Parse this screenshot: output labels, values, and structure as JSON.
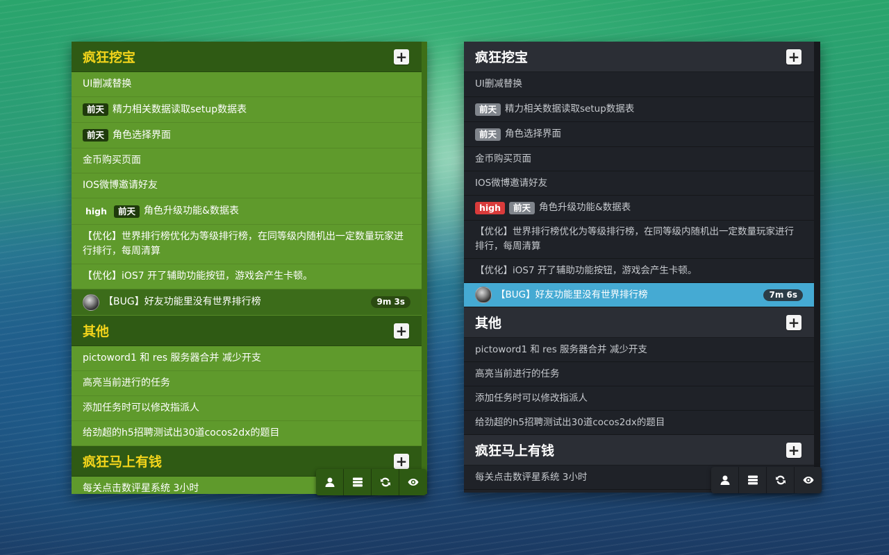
{
  "icons": {
    "add": "plus-icon",
    "user": "user-icon",
    "list": "list-icon",
    "refresh": "refresh-icon",
    "eye": "eye-icon"
  },
  "colors": {
    "green_panel": "#5f9a2c",
    "green_title": "#f4d51b",
    "dark_panel": "#1f2228",
    "active_blue": "#45aad3",
    "high_red": "#d93b3b"
  },
  "add_label": "+",
  "badges": {
    "day": "前天",
    "high": "high"
  },
  "left": {
    "groups": [
      {
        "title": "疯狂挖宝",
        "tasks": [
          {
            "text": "UI删减替换"
          },
          {
            "day": "前天",
            "text": "精力相关数据读取setup数据表"
          },
          {
            "day": "前天",
            "text": "角色选择界面"
          },
          {
            "text": "金币购买页面"
          },
          {
            "text": "IOS微博邀请好友"
          },
          {
            "high": "high",
            "day": "前天",
            "text": "角色升级功能&数据表"
          },
          {
            "text": "【优化】世界排行榜优化为等级排行榜，在同等级内随机出一定数量玩家进行排行，每周清算"
          },
          {
            "text": "【优化】iOS7 开了辅助功能按钮，游戏会产生卡顿。"
          },
          {
            "text": "【BUG】好友功能里没有世界排行榜",
            "timer": "9m 3s"
          }
        ]
      },
      {
        "title": "其他",
        "tasks": [
          {
            "text": "pictoword1 和 res 服务器合并 减少开支"
          },
          {
            "text": "高亮当前进行的任务"
          },
          {
            "text": "添加任务时可以修改指派人"
          },
          {
            "text": "给劲超的h5招聘测试出30道cocos2dx的题目"
          }
        ]
      },
      {
        "title": "疯狂马上有钱",
        "tasks": [
          {
            "text": "每关点击数评星系统 3小时"
          }
        ]
      }
    ]
  },
  "right": {
    "groups": [
      {
        "title": "疯狂挖宝",
        "tasks": [
          {
            "text": "UI删减替换"
          },
          {
            "day": "前天",
            "text": "精力相关数据读取setup数据表"
          },
          {
            "day": "前天",
            "text": "角色选择界面"
          },
          {
            "text": "金币购买页面"
          },
          {
            "text": "IOS微博邀请好友"
          },
          {
            "high": "high",
            "day": "前天",
            "text": "角色升级功能&数据表"
          },
          {
            "text": "【优化】世界排行榜优化为等级排行榜，在同等级内随机出一定数量玩家进行排行，每周清算"
          },
          {
            "text": "【优化】iOS7 开了辅助功能按钮，游戏会产生卡顿。"
          },
          {
            "text": "【BUG】好友功能里没有世界排行榜",
            "timer": "7m 6s"
          }
        ]
      },
      {
        "title": "其他",
        "tasks": [
          {
            "text": "pictoword1 和 res 服务器合并 减少开支"
          },
          {
            "text": "高亮当前进行的任务"
          },
          {
            "text": "添加任务时可以修改指派人"
          },
          {
            "text": "给劲超的h5招聘测试出30道cocos2dx的题目"
          }
        ]
      },
      {
        "title": "疯狂马上有钱",
        "tasks": [
          {
            "text": "每关点击数评星系统 3小时"
          }
        ]
      }
    ]
  }
}
